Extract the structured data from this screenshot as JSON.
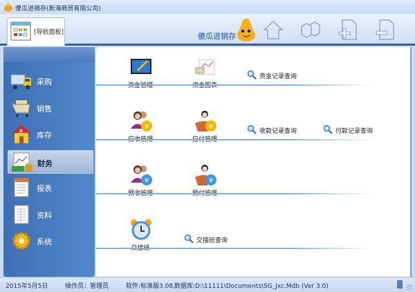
{
  "window": {
    "title": "傻瓜进销存(新海商贸有限公司)"
  },
  "toolbar": {
    "nav_tab": "[导航面板]",
    "logo_text": "傻瓜进销存",
    "buttons": [
      "home-icon",
      "modules-icon",
      "add-page-icon",
      "remove-page-icon"
    ]
  },
  "sidebar": {
    "items": [
      {
        "label": "采购",
        "icon": "truck-icon"
      },
      {
        "label": "销售",
        "icon": "cart-icon"
      },
      {
        "label": "库存",
        "icon": "house-icon"
      },
      {
        "label": "财务",
        "icon": "finance-icon",
        "selected": true
      },
      {
        "label": "报表",
        "icon": "report-icon"
      },
      {
        "label": "资料",
        "icon": "document-icon"
      },
      {
        "label": "系统",
        "icon": "gear-icon"
      }
    ]
  },
  "content": {
    "row1": {
      "items": [
        "资金管理",
        "资金图表"
      ],
      "queries": [
        "资金记录查询"
      ]
    },
    "row2": {
      "items": [
        "应收管理",
        "应付管理"
      ],
      "queries": [
        "收款记录查询",
        "付款记录查询"
      ]
    },
    "row3": {
      "items": [
        "预收管理",
        "预付管理"
      ]
    },
    "row4": {
      "items": [
        "交接班"
      ],
      "queries": [
        "交接班查询"
      ]
    }
  },
  "status": {
    "date": "2015年5月5日",
    "operator": "操作员：管理员",
    "software": "软件:标准版3.08,",
    "database": "数据库:D:\\11111\\Documents\\SG_Jxc.Mdb (Ver 3.0)"
  }
}
